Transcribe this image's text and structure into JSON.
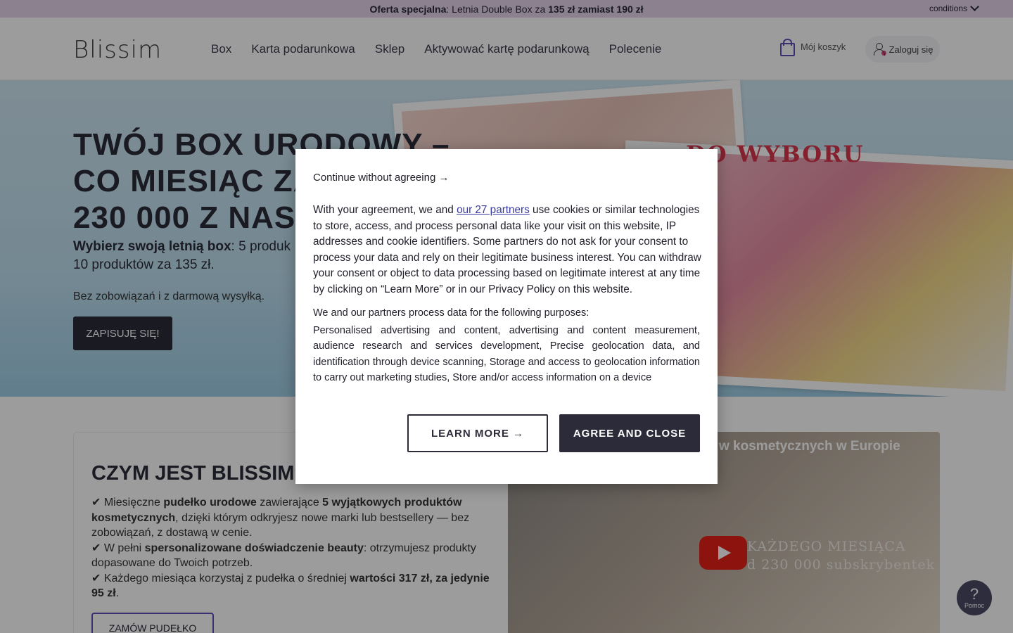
{
  "promo": {
    "strong": "Oferta specjalna",
    "text": ": Letnia Double Box za ",
    "price_new": "135 zł zamiast 190 zł",
    "conditions": "conditions"
  },
  "header": {
    "logo": "Blissim",
    "nav": [
      "Box",
      "Karta podarunkowa",
      "Sklep",
      "Aktywować kartę podarunkową",
      "Polecenie"
    ],
    "cart": "Mój koszyk",
    "login": "Zaloguj się"
  },
  "hero": {
    "title_lines": [
      "TWÓJ BOX URODOWY –",
      "CO MIESIĄC ZA",
      "230 000 Z NAS"
    ],
    "sub_strong": "Wybierz swoją letnią box",
    "sub_rest": ": 5 produk",
    "sub_line2": "10 produktów za 135 zł.",
    "note": "Bez zobowiązań i z darmową wysyłką.",
    "cta": "ZAPISUJĘ SIĘ!",
    "image_badge": "DO WYBORU"
  },
  "about": {
    "title": "CZYM JEST BLISSIM?",
    "bullets": [
      {
        "prefix": "✔ Miesięczne ",
        "b1": "pudełko urodowe",
        "mid": " zawierające ",
        "b2": "5 wyjątkowych produktów kosmetycznych",
        "rest": ", dzięki którym odkryjesz nowe marki lub bestsellery — bez zobowiązań, z dostawą w cenie."
      },
      {
        "prefix": "✔ W pełni ",
        "b1": "spersonalizowane doświadczenie beauty",
        "rest": ": otrzymujesz produkty dopasowane do Twoich potrzeb."
      },
      {
        "prefix": "✔ Każdego miesiąca korzystaj z pudełka o średniej ",
        "b1": "wartości 317 zł, za jedynie 95 zł",
        "rest": "."
      }
    ],
    "cta": "ZAMÓW PUDEŁKO"
  },
  "video": {
    "title": "w kosmetycznych w Europie",
    "overlay_line1": "KAŻDEGO MIESIĄCA",
    "overlay_line2": "d 230 000 subskrybentek"
  },
  "help": {
    "icon": "?",
    "label": "Pomoc"
  },
  "dialog": {
    "continue": "Continue without agreeing →",
    "consent_pre": "With your agreement, we and ",
    "partners_link": "our 27 partners",
    "consent_post": " use cookies or similar technologies to store, access, and process personal data like your visit on this website, IP addresses and cookie identifiers. Some partners do not ask for your consent to process your data and rely on their legitimate business interest. You can withdraw your consent or object to data processing based on legitimate interest at any time by clicking on “Learn More” or in our Privacy Policy on this website.",
    "purposes_head": "We and our partners process data for the following purposes:",
    "purposes": "Personalised advertising and content, advertising and content measurement, audience research and services development, Precise geolocation data, and identification through device scanning, Storage and access to geolocation information to carry out marketing studies, Store and/or access information on a device",
    "learn_more": "LEARN MORE →",
    "agree": "AGREE AND CLOSE"
  }
}
